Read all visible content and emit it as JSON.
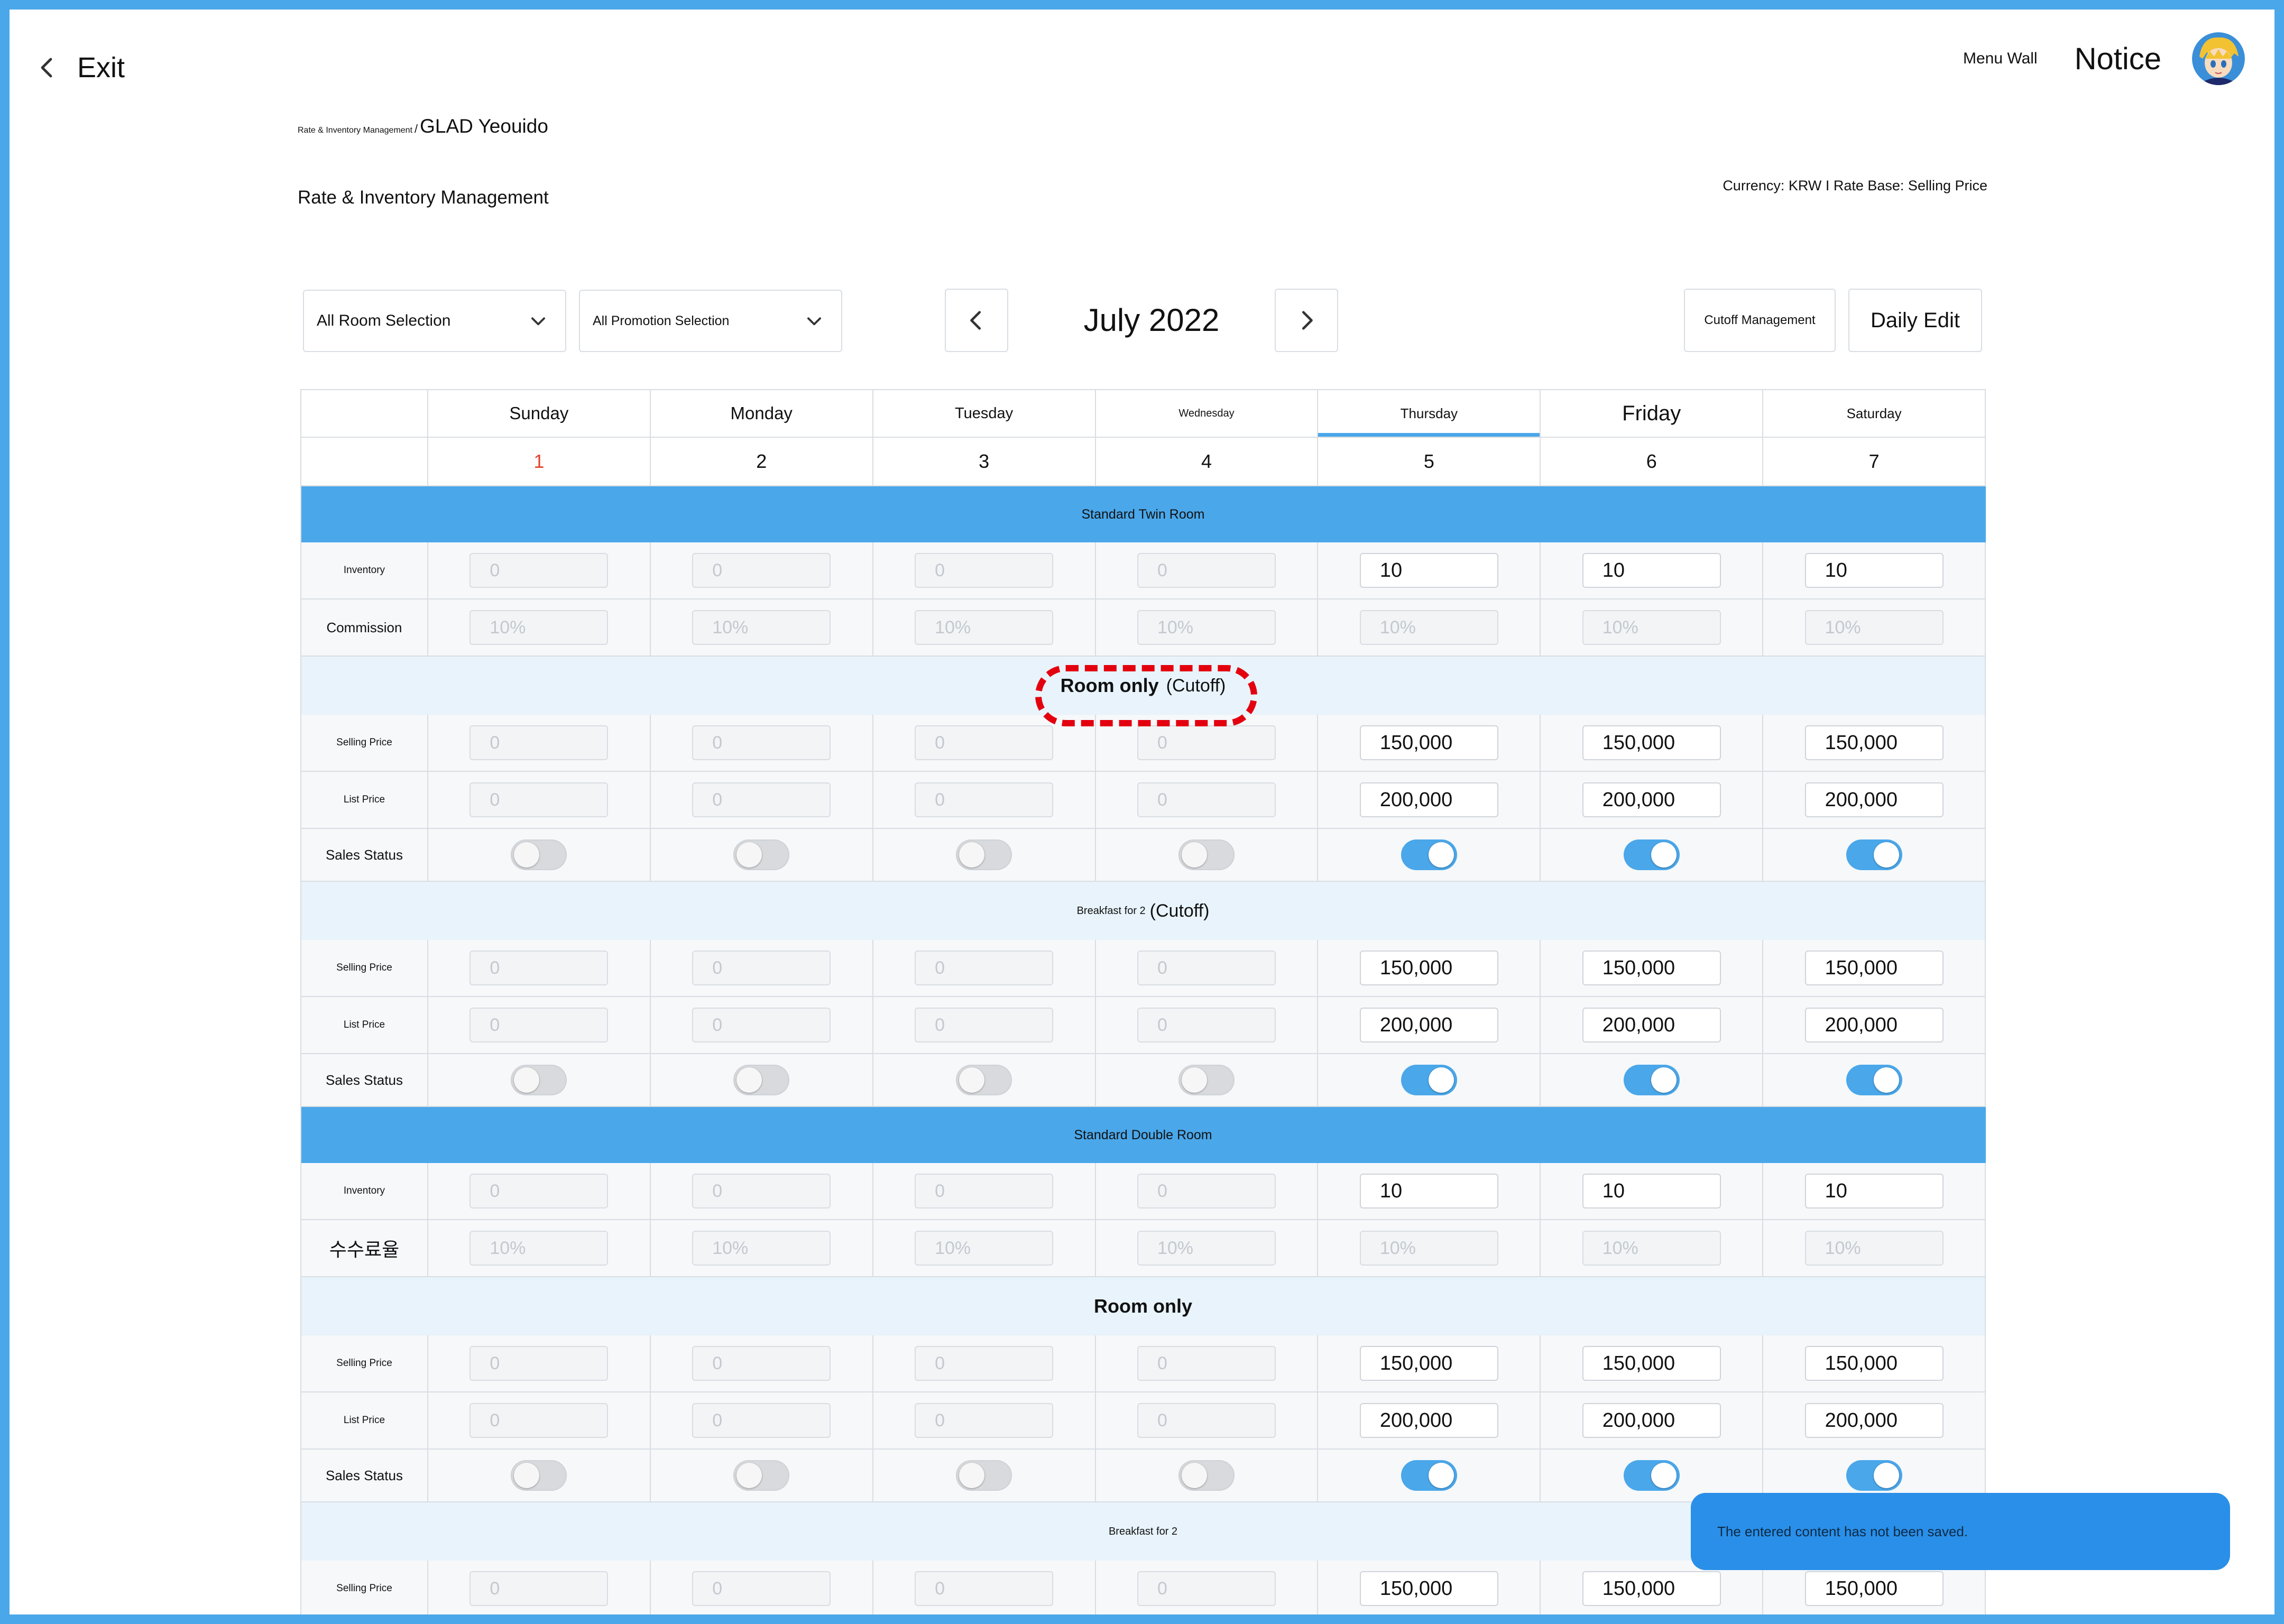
{
  "topbar": {
    "exit_label": "Exit",
    "menu_wall": "Menu Wall",
    "notice": "Notice"
  },
  "header": {
    "breadcrumb_parent": "Rate & Inventory Management",
    "breadcrumb_separator": "/",
    "breadcrumb_current": "GLAD Yeouido",
    "title": "Rate & Inventory Management",
    "currency_info": "Currency: KRW I Rate Base: Selling Price"
  },
  "toolbar": {
    "room_select": "All Room Selection",
    "promotion_select": "All Promotion Selection",
    "month": "July 2022",
    "cutoff_button": "Cutoff Management",
    "daily_edit_button": "Daily Edit"
  },
  "days": [
    "Sunday",
    "Monday",
    "Tuesday",
    "Wednesday",
    "Thursday",
    "Friday",
    "Saturday"
  ],
  "dates": [
    "1",
    "2",
    "3",
    "4",
    "5",
    "6",
    "7"
  ],
  "colors": {
    "accent": "#4aa7ea",
    "sunday": "#e2442f",
    "highlight": "#e3000f",
    "toast": "#2a8fe8"
  },
  "rooms": {
    "twin": {
      "name": "Standard Twin Room",
      "inventory_label": "Inventory",
      "commission_label": "Commission",
      "inventory": [
        "0",
        "0",
        "0",
        "0",
        "10",
        "10",
        "10"
      ],
      "commission": [
        "10%",
        "10%",
        "10%",
        "10%",
        "10%",
        "10%",
        "10%"
      ],
      "plan1": {
        "name": "Room only",
        "tag": "(Cutoff)",
        "selling_label": "Selling Price",
        "list_label": "List Price",
        "status_label": "Sales Status",
        "selling": [
          "0",
          "0",
          "0",
          "0",
          "150,000",
          "150,000",
          "150,000"
        ],
        "list": [
          "0",
          "0",
          "0",
          "0",
          "200,000",
          "200,000",
          "200,000"
        ]
      },
      "plan2": {
        "name": "Breakfast for 2",
        "tag": "(Cutoff)",
        "selling_label": "Selling Price",
        "list_label": "List Price",
        "status_label": "Sales Status",
        "selling": [
          "0",
          "0",
          "0",
          "0",
          "150,000",
          "150,000",
          "150,000"
        ],
        "list": [
          "0",
          "0",
          "0",
          "0",
          "200,000",
          "200,000",
          "200,000"
        ]
      }
    },
    "double": {
      "name": "Standard Double Room",
      "inventory_label": "Inventory",
      "commission_label": "수수료율",
      "inventory": [
        "0",
        "0",
        "0",
        "0",
        "10",
        "10",
        "10"
      ],
      "commission": [
        "10%",
        "10%",
        "10%",
        "10%",
        "10%",
        "10%",
        "10%"
      ],
      "plan1": {
        "name": "Room only",
        "selling_label": "Selling Price",
        "list_label": "List Price",
        "status_label": "Sales Status",
        "selling": [
          "0",
          "0",
          "0",
          "0",
          "150,000",
          "150,000",
          "150,000"
        ],
        "list": [
          "0",
          "0",
          "0",
          "0",
          "200,000",
          "200,000",
          "200,000"
        ]
      },
      "plan2": {
        "name": "Breakfast for 2",
        "selling_label": "Selling Price",
        "selling": [
          "0",
          "0",
          "0",
          "0",
          "150,000",
          "150,000",
          "150,000"
        ]
      }
    }
  },
  "toast": "The entered content has not been saved."
}
